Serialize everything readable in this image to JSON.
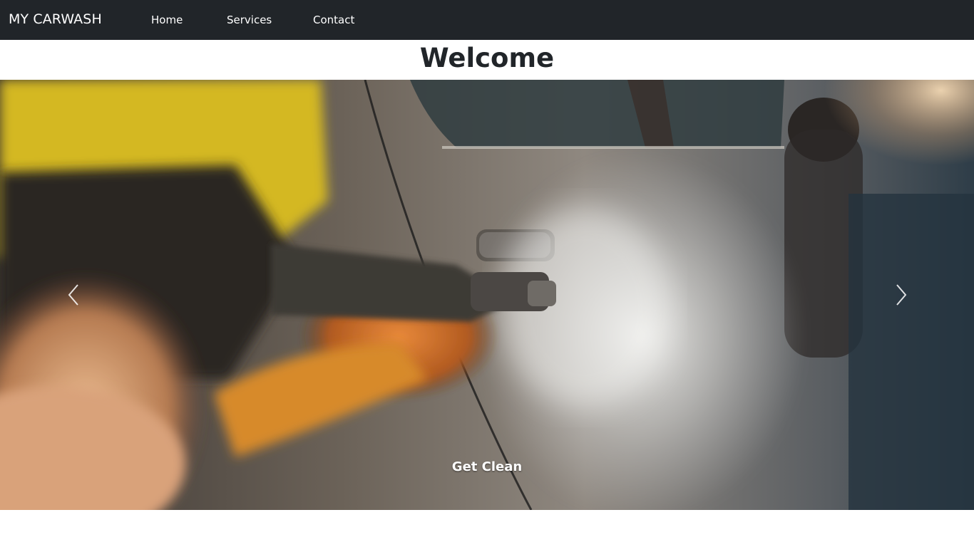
{
  "navbar": {
    "brand": "MY CARWASH",
    "links": [
      {
        "label": "Home"
      },
      {
        "label": "Services"
      },
      {
        "label": "Contact"
      }
    ],
    "background": "#212529"
  },
  "main": {
    "heading": "Welcome"
  },
  "carousel": {
    "slides": [
      {
        "caption": "Get Clean",
        "image": "pressure-washer-spraying-car-door"
      }
    ],
    "prev_icon": "chevron-left-icon",
    "next_icon": "chevron-right-icon"
  }
}
